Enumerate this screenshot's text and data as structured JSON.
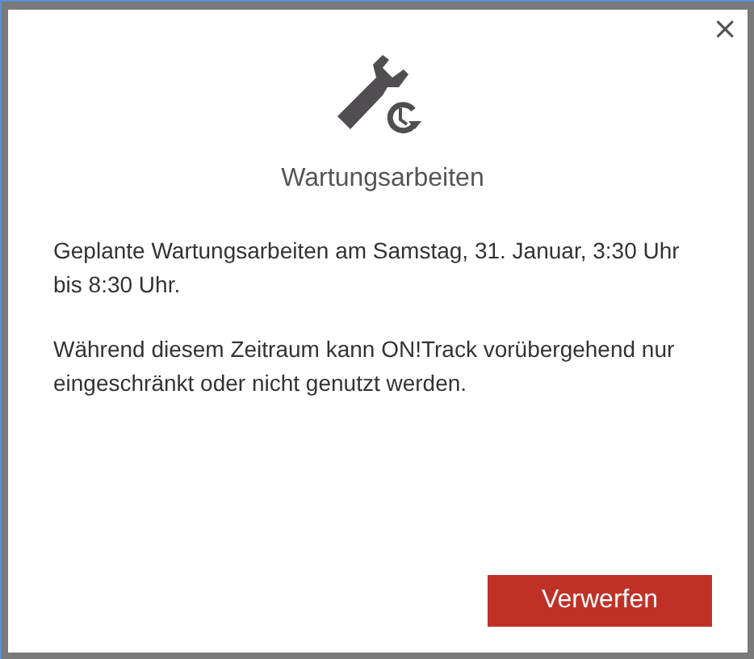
{
  "dialog": {
    "close": "×",
    "title": "Wartungsarbeiten",
    "paragraphs": [
      "Geplante Wartungsarbeiten am Samstag, 31. Januar, 3:30 Uhr bis 8:30 Uhr.",
      "Während diesem Zeitraum kann ON!Track vorübergehend nur eingeschränkt oder nicht genutzt werden."
    ],
    "button": "Verwerfen"
  }
}
